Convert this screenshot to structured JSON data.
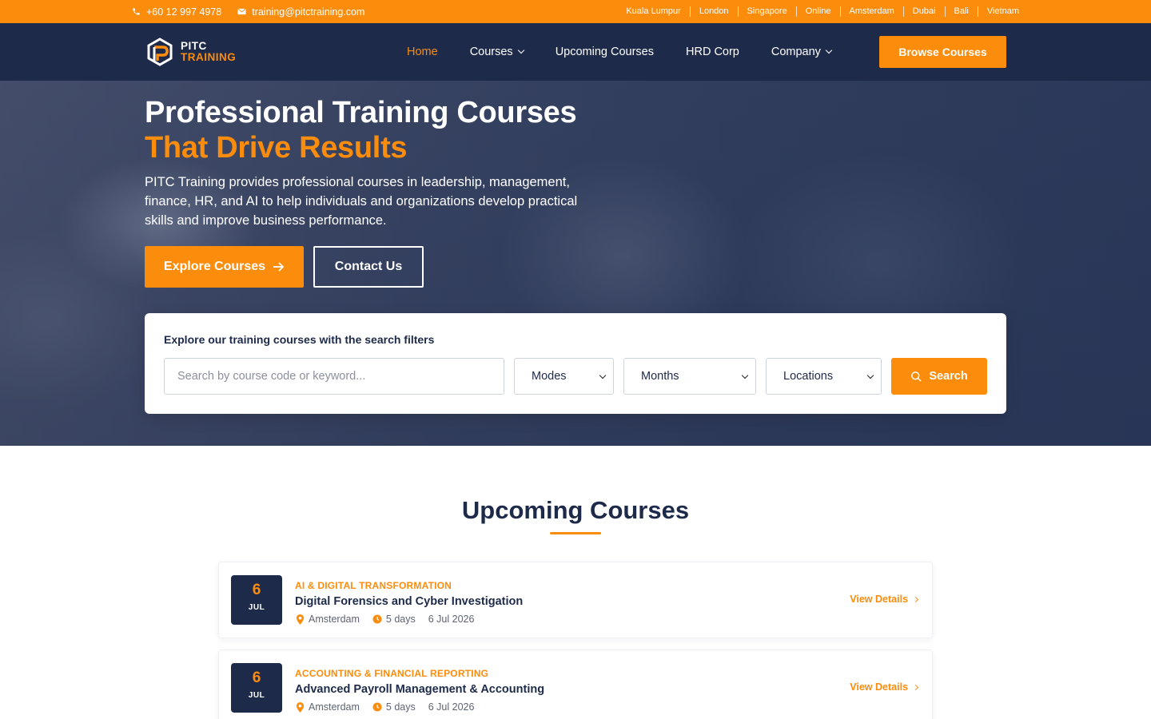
{
  "topbar": {
    "phone": "+60 12 997 4978",
    "email": "training@pitctraining.com",
    "locations": [
      "Kuala Lumpur",
      "London",
      "Singapore",
      "Online",
      "Amsterdam",
      "Dubai",
      "Bali",
      "Vietnam"
    ]
  },
  "nav": {
    "logo_line1": "PITC",
    "logo_line2": "TRAINING",
    "items": [
      {
        "label": "Home"
      },
      {
        "label": "Courses"
      },
      {
        "label": "Upcoming Courses"
      },
      {
        "label": "HRD Corp"
      },
      {
        "label": "Company"
      }
    ],
    "cta": "Browse Courses"
  },
  "hero": {
    "title_line1": "Professional Training Courses",
    "title_line2": "That Drive Results",
    "description": "PITC Training provides professional courses in leadership, management, finance, HR, and AI to help individuals and organizations develop practical skills and improve business performance.",
    "explore_label": "Explore Courses",
    "contact_label": "Contact Us"
  },
  "search": {
    "label": "Explore our training courses with the search filters",
    "placeholder": "Search by course code or keyword...",
    "modes": "Modes",
    "months": "Months",
    "locations": "Locations",
    "button": "Search"
  },
  "upcoming": {
    "title": "Upcoming Courses",
    "view_label": "View Details",
    "courses": [
      {
        "day": "6",
        "month": "JUL",
        "category": "AI & DIGITAL TRANSFORMATION",
        "title": "Digital Forensics and Cyber Investigation",
        "location": "Amsterdam",
        "duration": "5 days",
        "date": "6 Jul 2026"
      },
      {
        "day": "6",
        "month": "JUL",
        "category": "ACCOUNTING & FINANCIAL REPORTING",
        "title": "Advanced Payroll Management & Accounting",
        "location": "Amsterdam",
        "duration": "5 days",
        "date": "6 Jul 2026"
      }
    ]
  },
  "colors": {
    "accent": "#fb8c0c",
    "navy": "#1e2a4a"
  }
}
